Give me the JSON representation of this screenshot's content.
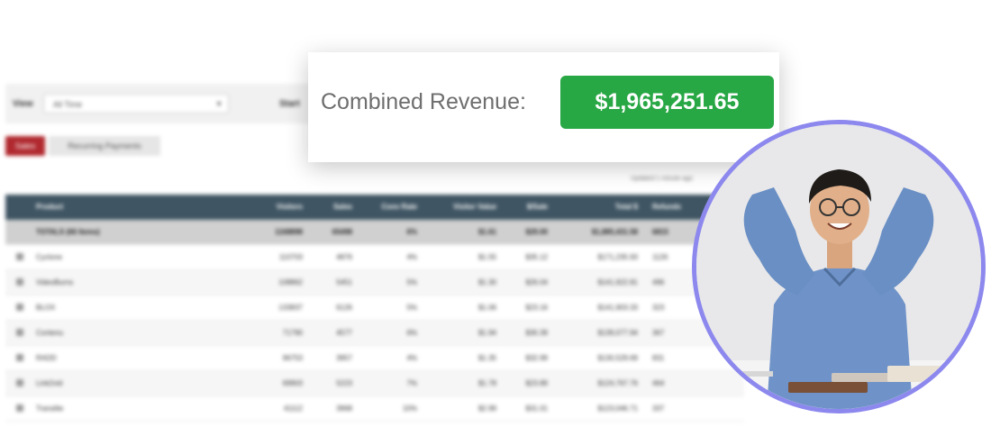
{
  "dashboard": {
    "view_label": "View",
    "view_selected": "All Time",
    "start_label": "Start",
    "tabs": [
      "Sales",
      "Recurring Payments"
    ],
    "updated_text": "Updated 1 minute ago",
    "columns": [
      "Product",
      "Visitors",
      "Sales",
      "Conv Rate",
      "Visitor Value",
      "$/Sale",
      "Total $",
      "Refunds"
    ],
    "totals": [
      "TOTALS (66 Items)",
      "1168898",
      "65498",
      "6%",
      "$1.61",
      "$29.00",
      "$1,885,431.58",
      "6815"
    ],
    "rows": [
      [
        "Cyclone",
        "110703",
        "4876",
        "4%",
        "$1.55",
        "$35.12",
        "$171,235.93",
        "1126"
      ],
      [
        "VideoBurns",
        "108862",
        "5451",
        "5%",
        "$1.30",
        "$26.04",
        "$141,922.81",
        "496"
      ],
      [
        "BLOX",
        "133837",
        "6126",
        "5%",
        "$1.06",
        "$23.16",
        "$141,903.33",
        "323"
      ],
      [
        "Contenu",
        "71790",
        "4577",
        "6%",
        "$1.94",
        "$30.39",
        "$139,077.94",
        "367"
      ],
      [
        "RADD",
        "96753",
        "3957",
        "4%",
        "$1.35",
        "$32.99",
        "$130,529.69",
        "831"
      ],
      [
        "Link2vid",
        "69903",
        "5223",
        "7%",
        "$1.78",
        "$23.89",
        "$124,767.76",
        "464"
      ],
      [
        "Translite",
        "41112",
        "3968",
        "10%",
        "$2.99",
        "$31.01",
        "$123,046.71",
        "337"
      ]
    ]
  },
  "revenue": {
    "label": "Combined Revenue:",
    "value": "$1,965,251.65"
  },
  "colors": {
    "badge_green": "#28a745",
    "header_slate": "#3f5563",
    "tab_red": "#b0292f",
    "circle_border": "#8c88ee"
  }
}
